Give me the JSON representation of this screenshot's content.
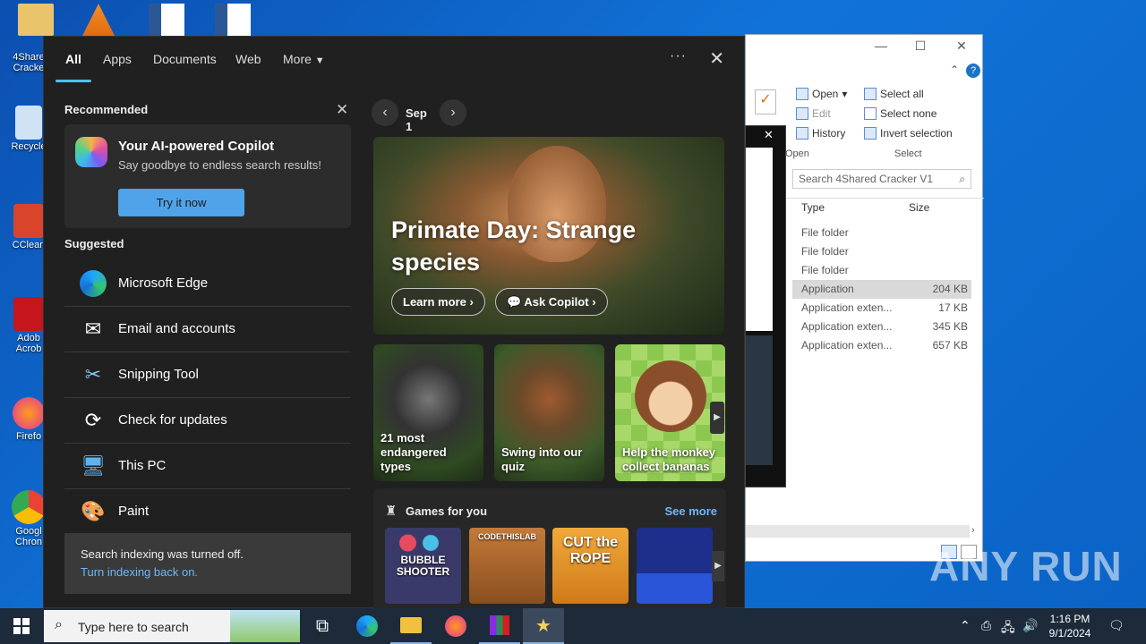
{
  "desktop_icons": [
    {
      "label": "4Share\nCracke"
    },
    {
      "label": "Recycle"
    },
    {
      "label": "CClean"
    },
    {
      "label": "Adob\nAcrob"
    },
    {
      "label": "Firefo"
    },
    {
      "label": "Googl\nChron"
    }
  ],
  "explorer": {
    "ribbon": {
      "open": "Open",
      "edit": "Edit",
      "history": "History",
      "open_group": "Open",
      "select_all": "Select all",
      "select_none": "Select none",
      "invert_selection": "Invert selection",
      "select_group": "Select"
    },
    "search_placeholder": "Search 4Shared Cracker V1",
    "columns": {
      "type": "Type",
      "size": "Size"
    },
    "rows": [
      {
        "type": "File folder",
        "size": ""
      },
      {
        "type": "File folder",
        "size": ""
      },
      {
        "type": "File folder",
        "size": ""
      },
      {
        "type": "Application",
        "size": "204 KB"
      },
      {
        "type": "Application exten...",
        "size": "17 KB"
      },
      {
        "type": "Application exten...",
        "size": "345 KB"
      },
      {
        "type": "Application exten...",
        "size": "657 KB"
      }
    ]
  },
  "search_panel": {
    "tabs": [
      "All",
      "Apps",
      "Documents",
      "Web",
      "More"
    ],
    "recommended_title": "Recommended",
    "copilot": {
      "title": "Your AI-powered Copilot",
      "subtitle": "Say goodbye to endless search results!",
      "button": "Try it now"
    },
    "suggested_title": "Suggested",
    "suggested": [
      {
        "label": "Microsoft Edge",
        "icon": "edge-icon"
      },
      {
        "label": "Email and accounts",
        "icon": "mail-icon"
      },
      {
        "label": "Snipping Tool",
        "icon": "snipping-tool-icon"
      },
      {
        "label": "Check for updates",
        "icon": "refresh-icon"
      },
      {
        "label": "This PC",
        "icon": "computer-icon"
      },
      {
        "label": "Paint",
        "icon": "paint-palette-icon"
      }
    ],
    "indexing": {
      "message": "Search indexing was turned off.",
      "link": "Turn indexing back on."
    },
    "date_label": "Sep 1",
    "hero": {
      "title": "Primate Day: Strange species",
      "learn_more": "Learn more",
      "ask_copilot": "Ask Copilot"
    },
    "tiles": [
      {
        "caption": "21 most endangered types"
      },
      {
        "caption": "Swing into our quiz"
      },
      {
        "caption": "Help the monkey collect bananas"
      }
    ],
    "games": {
      "title": "Games for you",
      "see_more": "See more",
      "items": [
        "BUBBLE SHOOTER",
        "CODETHISLAB",
        "CUT the ROPE",
        ""
      ]
    }
  },
  "taskbar": {
    "search_placeholder": "Type here to search",
    "time": "1:16 PM",
    "date": "9/1/2024"
  },
  "watermark": "ANY RUN"
}
